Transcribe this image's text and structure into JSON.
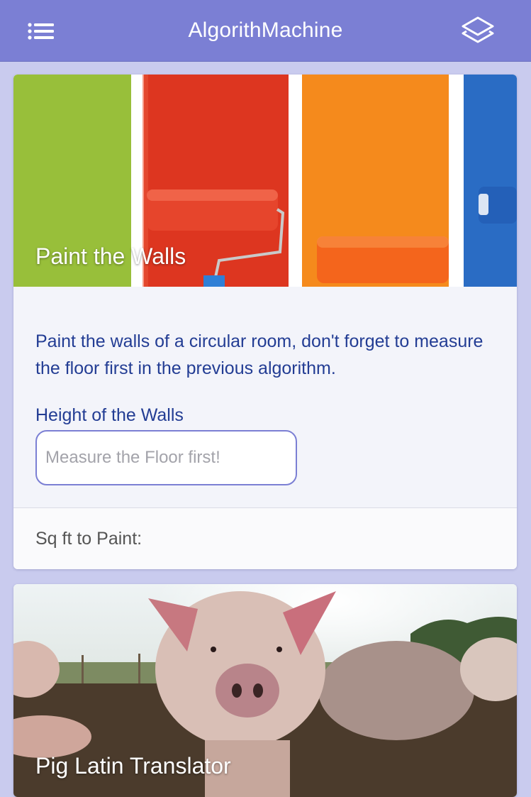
{
  "navbar": {
    "title": "AlgorithMachine",
    "menu_icon": "list-icon",
    "layers_icon": "layers-icon",
    "background": "#7b7fd4"
  },
  "cards": [
    {
      "title": "Paint the Walls",
      "image": "paint-rollers-image",
      "description": "Paint the walls of a circular room, don't forget to measure the floor first in the previous algorithm.",
      "field_label": "Height of the Walls",
      "input_value": "",
      "input_placeholder": "Measure the Floor first!",
      "result_label": "Sq ft to Paint:"
    },
    {
      "title": "Pig Latin Translator",
      "image": "pigs-image"
    }
  ],
  "colors": {
    "accent": "#7b7fd4",
    "text_blue": "#233d94",
    "page_bg": "#c9cbee"
  }
}
